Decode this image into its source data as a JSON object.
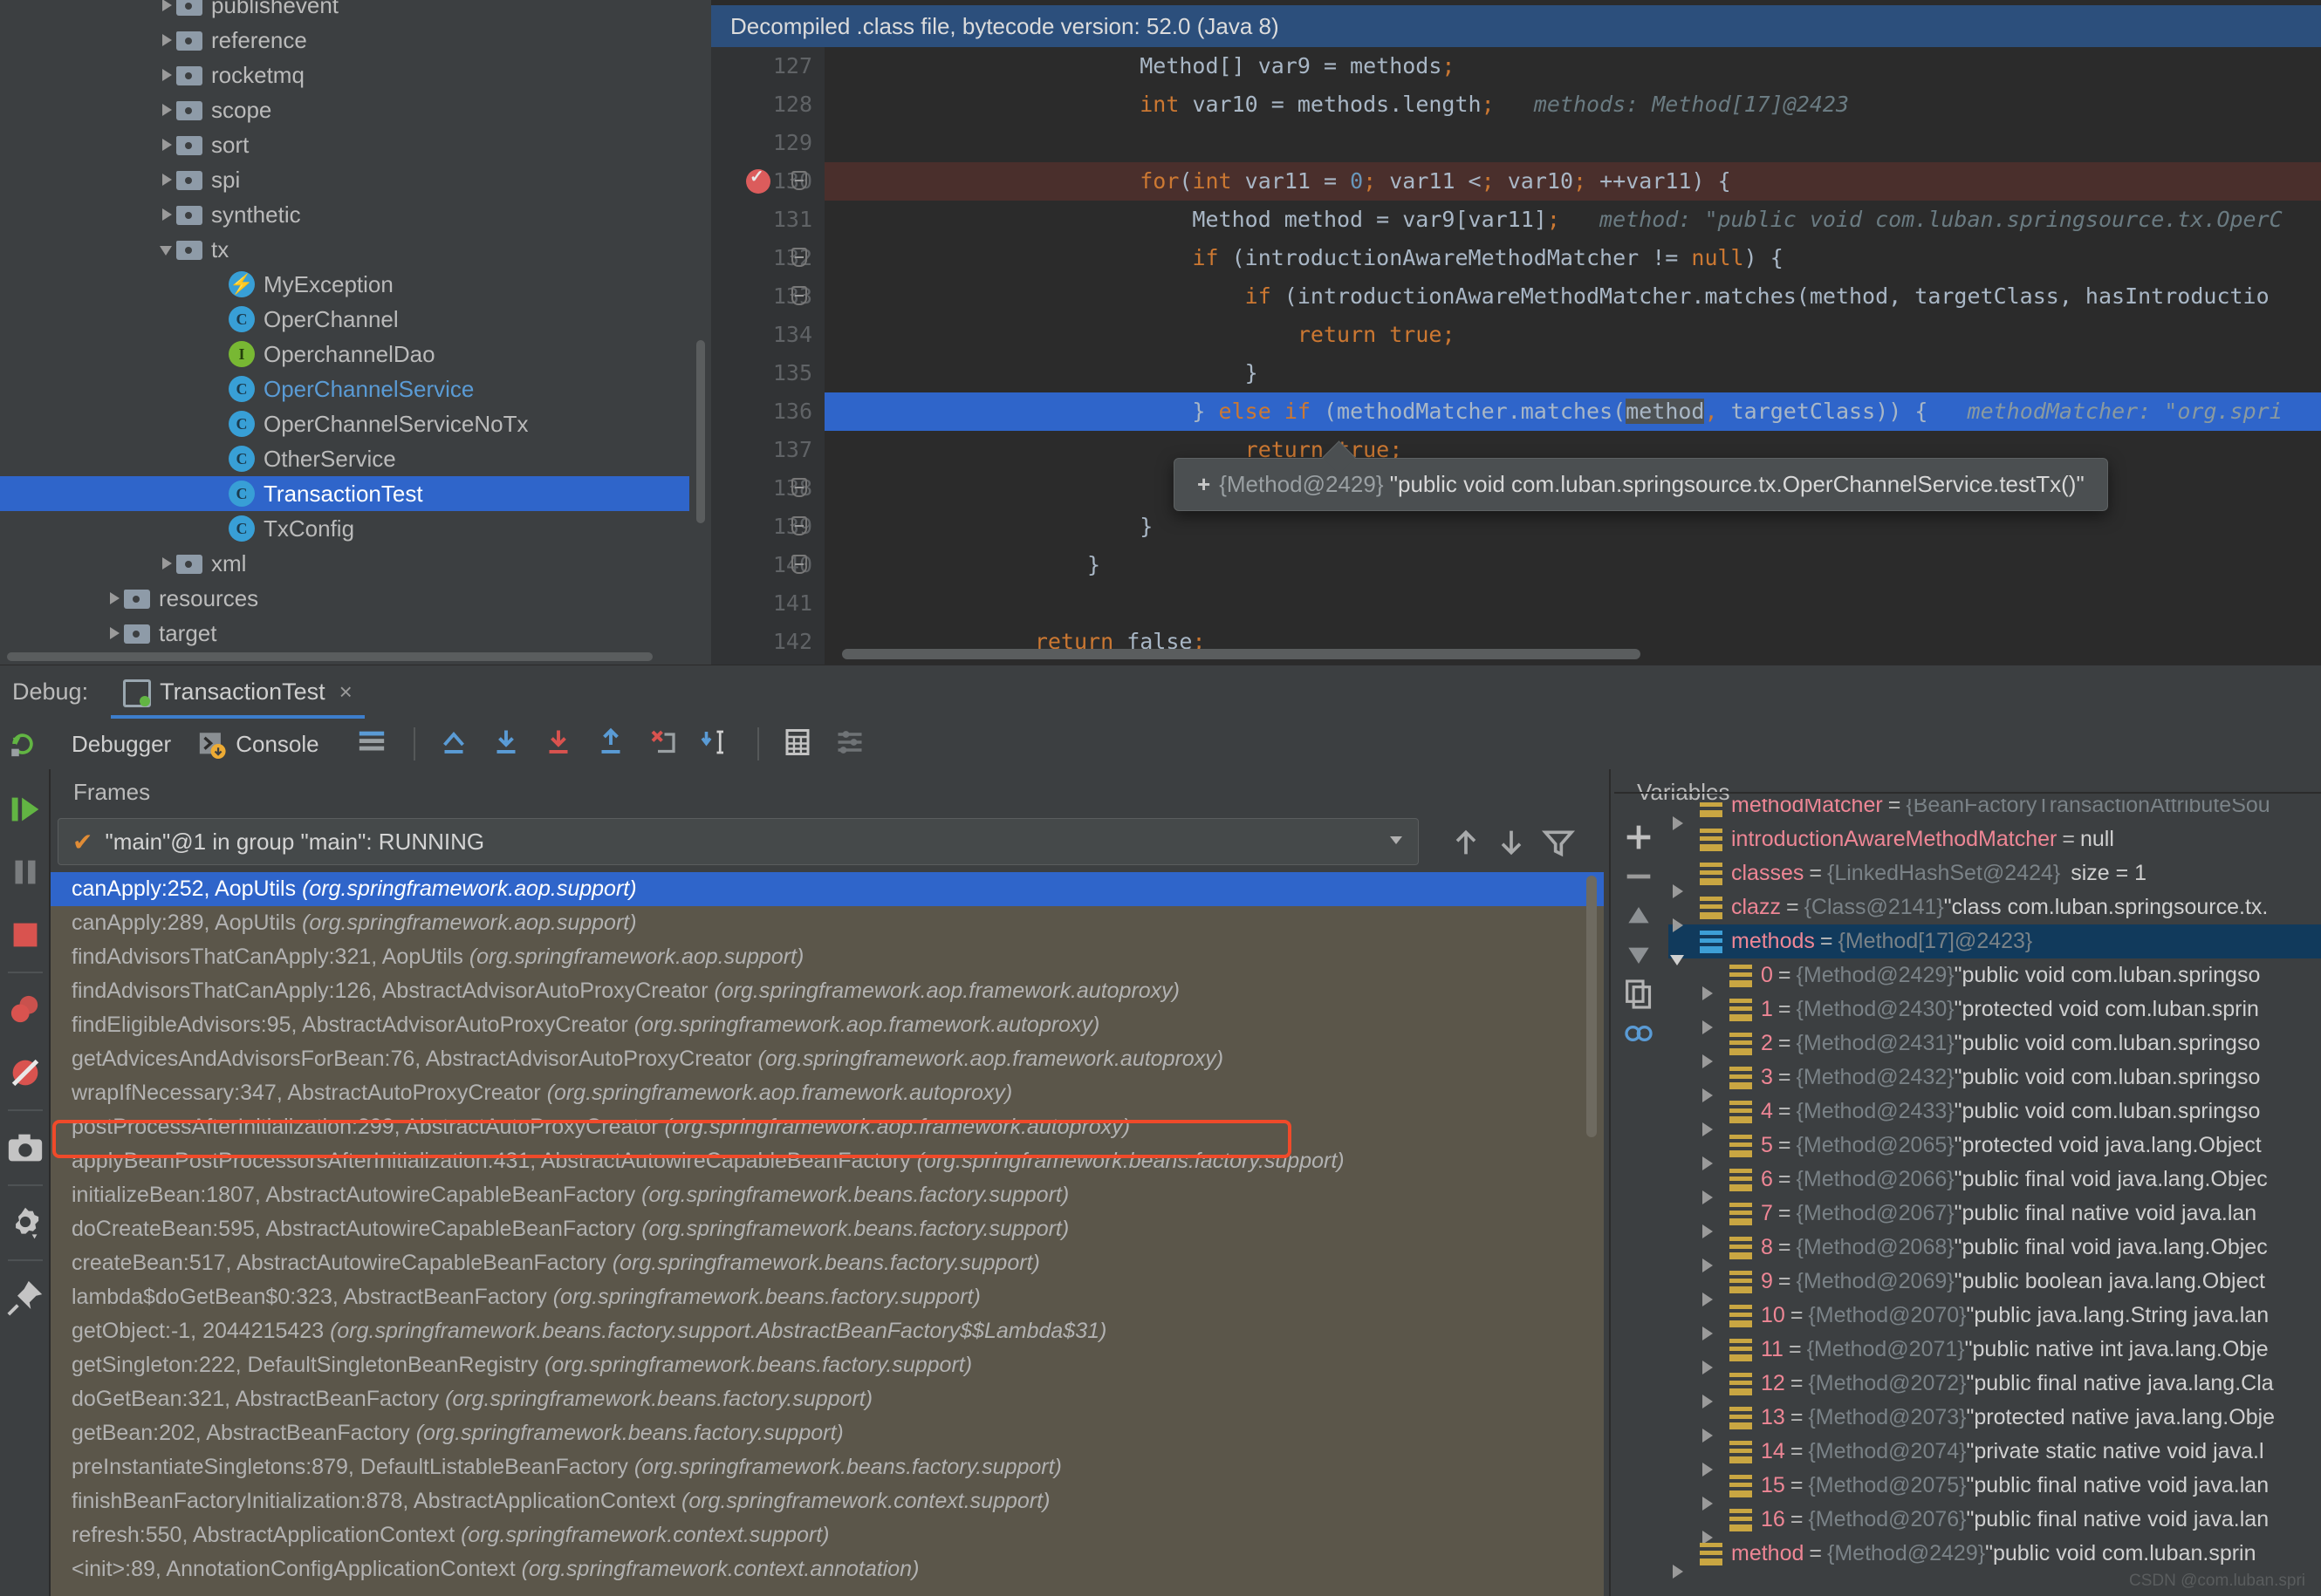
{
  "project_tree": {
    "items": [
      {
        "label": "publishevent",
        "type": "folder",
        "arrow": "closed",
        "indent": 1,
        "selected": false,
        "partial": true
      },
      {
        "label": "reference",
        "type": "folder",
        "arrow": "closed",
        "indent": 1,
        "selected": false
      },
      {
        "label": "rocketmq",
        "type": "folder",
        "arrow": "closed",
        "indent": 1,
        "selected": false
      },
      {
        "label": "scope",
        "type": "folder",
        "arrow": "closed",
        "indent": 1,
        "selected": false
      },
      {
        "label": "sort",
        "type": "folder",
        "arrow": "closed",
        "indent": 1,
        "selected": false
      },
      {
        "label": "spi",
        "type": "folder",
        "arrow": "closed",
        "indent": 1,
        "selected": false
      },
      {
        "label": "synthetic",
        "type": "folder",
        "arrow": "closed",
        "indent": 1,
        "selected": false
      },
      {
        "label": "tx",
        "type": "folder",
        "arrow": "open",
        "indent": 1,
        "selected": false
      },
      {
        "label": "MyException",
        "type": "exception",
        "arrow": "none",
        "indent": 2,
        "selected": false
      },
      {
        "label": "OperChannel",
        "type": "class",
        "arrow": "none",
        "indent": 2,
        "selected": false
      },
      {
        "label": "OperchannelDao",
        "type": "interface",
        "arrow": "none",
        "indent": 2,
        "selected": false
      },
      {
        "label": "OperChannelService",
        "type": "class",
        "arrow": "none",
        "indent": 2,
        "selected": false,
        "blue": true
      },
      {
        "label": "OperChannelServiceNoTx",
        "type": "class",
        "arrow": "none",
        "indent": 2,
        "selected": false
      },
      {
        "label": "OtherService",
        "type": "class",
        "arrow": "none",
        "indent": 2,
        "selected": false
      },
      {
        "label": "TransactionTest",
        "type": "class",
        "arrow": "none",
        "indent": 2,
        "selected": true
      },
      {
        "label": "TxConfig",
        "type": "class",
        "arrow": "none",
        "indent": 2,
        "selected": false
      },
      {
        "label": "xml",
        "type": "folder",
        "arrow": "closed",
        "indent": 1,
        "selected": false
      },
      {
        "label": "resources",
        "type": "folder",
        "arrow": "closed",
        "indent": 0,
        "selected": false
      },
      {
        "label": "target",
        "type": "folder",
        "arrow": "closed",
        "indent": 0,
        "selected": false
      }
    ]
  },
  "editor": {
    "decompiled_banner": "Decompiled .class file, bytecode version: 52.0 (Java 8)",
    "lines": [
      {
        "num": "127",
        "indent": "                        ",
        "html": "Method[] var9 = methods;",
        "hint": "",
        "state": "normal",
        "fold": false
      },
      {
        "num": "128",
        "indent": "                        ",
        "html": "int var10 = methods.length;",
        "hint": "methods: Method[17]@2423",
        "state": "normal",
        "fold": false
      },
      {
        "num": "129",
        "indent": "",
        "html": "",
        "hint": "",
        "state": "normal",
        "fold": false
      },
      {
        "num": "130",
        "indent": "                        ",
        "html": "for(int var11 = 0; var11 < var10; ++var11) {",
        "hint": "",
        "state": "breakpoint",
        "fold": true
      },
      {
        "num": "131",
        "indent": "                            ",
        "html": "Method method = var9[var11];",
        "hint": "method: \"public void com.luban.springsource.tx.OperC",
        "state": "normal",
        "fold": false
      },
      {
        "num": "132",
        "indent": "                            ",
        "html": "if (introductionAwareMethodMatcher != null) {",
        "hint": "",
        "state": "normal",
        "fold": true
      },
      {
        "num": "133",
        "indent": "                                ",
        "html": "if (introductionAwareMethodMatcher.matches(method, targetClass, hasIntroductio",
        "hint": "",
        "state": "normal",
        "fold": true
      },
      {
        "num": "134",
        "indent": "                                    ",
        "html": "return true;",
        "hint": "",
        "state": "normal",
        "fold": false
      },
      {
        "num": "135",
        "indent": "                                ",
        "html": "}",
        "hint": "",
        "state": "normal",
        "fold": false
      },
      {
        "num": "136",
        "indent": "                            ",
        "html": "} else if (methodMatcher.matches(method, targetClass)) {",
        "hint": "methodMatcher: \"org.spri",
        "state": "current",
        "fold": false
      },
      {
        "num": "137",
        "indent": "                                ",
        "html": "return true;",
        "hint": "",
        "state": "normal",
        "fold": false
      },
      {
        "num": "138",
        "indent": "                            ",
        "html": "}",
        "hint": "",
        "state": "normal",
        "fold": true
      },
      {
        "num": "139",
        "indent": "                        ",
        "html": "}",
        "hint": "",
        "state": "normal",
        "fold": true
      },
      {
        "num": "140",
        "indent": "                    ",
        "html": "}",
        "hint": "",
        "state": "normal",
        "fold": true
      },
      {
        "num": "141",
        "indent": "",
        "html": "",
        "hint": "",
        "state": "normal",
        "fold": false
      },
      {
        "num": "142",
        "indent": "                ",
        "html": "return false;",
        "hint": "",
        "state": "normal",
        "fold": false
      }
    ],
    "tooltip": {
      "plus": "+",
      "ref": "{Method@2429}",
      "value": "\"public void com.luban.springsource.tx.OperChannelService.testTx()\""
    }
  },
  "debug_header": {
    "label": "Debug:",
    "run_config": "TransactionTest",
    "close": "×"
  },
  "debug_toolbar": {
    "tabs": [
      {
        "label": "Debugger",
        "active": true,
        "icon": "debugger-icon"
      },
      {
        "label": "Console",
        "active": false,
        "icon": "console-icon"
      }
    ],
    "buttons": [
      {
        "name": "rerun-button",
        "icon": "rerun-icon"
      },
      {
        "name": "layout-settings-button",
        "icon": "lines-icon"
      },
      {
        "name": "show-execution-point-button",
        "icon": "execution-point-icon"
      },
      {
        "name": "step-over-button",
        "icon": "step-over-icon"
      },
      {
        "name": "step-into-button",
        "icon": "step-into-icon"
      },
      {
        "name": "step-out-button",
        "icon": "step-out-icon"
      },
      {
        "name": "force-step-into-button",
        "icon": "force-step-into-icon"
      },
      {
        "name": "run-to-cursor-button",
        "icon": "run-to-cursor-icon"
      },
      {
        "name": "evaluate-expression-button",
        "icon": "calculator-icon"
      },
      {
        "name": "settings-button",
        "icon": "sliders-icon"
      }
    ]
  },
  "left_rail": {
    "buttons": [
      {
        "name": "resume-program-button",
        "icon": "resume-icon"
      },
      {
        "name": "pause-program-button",
        "icon": "pause-icon"
      },
      {
        "name": "stop-button",
        "icon": "stop-icon"
      },
      {
        "name": "view-breakpoints-button",
        "icon": "breakpoints-icon"
      },
      {
        "name": "mute-breakpoints-button",
        "icon": "mute-breakpoints-icon"
      },
      {
        "name": "screenshot-button",
        "icon": "camera-icon"
      },
      {
        "name": "settings-button",
        "icon": "gear-icon"
      },
      {
        "name": "pin-tab-button",
        "icon": "pin-icon"
      }
    ]
  },
  "frames_panel": {
    "title": "Frames",
    "thread": "\"main\"@1 in group \"main\": RUNNING",
    "thread_check": "✔",
    "stack": [
      {
        "method": "canApply:252, AopUtils ",
        "pkg": "(org.springframework.aop.support)",
        "selected": true,
        "marked": false
      },
      {
        "method": "canApply:289, AopUtils ",
        "pkg": "(org.springframework.aop.support)",
        "selected": false,
        "marked": false
      },
      {
        "method": "findAdvisorsThatCanApply:321, AopUtils ",
        "pkg": "(org.springframework.aop.support)",
        "selected": false,
        "marked": false
      },
      {
        "method": "findAdvisorsThatCanApply:126, AbstractAdvisorAutoProxyCreator ",
        "pkg": "(org.springframework.aop.framework.autoproxy)",
        "selected": false,
        "marked": false
      },
      {
        "method": "findEligibleAdvisors:95, AbstractAdvisorAutoProxyCreator ",
        "pkg": "(org.springframework.aop.framework.autoproxy)",
        "selected": false,
        "marked": false
      },
      {
        "method": "getAdvicesAndAdvisorsForBean:76, AbstractAdvisorAutoProxyCreator ",
        "pkg": "(org.springframework.aop.framework.autoproxy)",
        "selected": false,
        "marked": false
      },
      {
        "method": "wrapIfNecessary:347, AbstractAutoProxyCreator ",
        "pkg": "(org.springframework.aop.framework.autoproxy)",
        "selected": false,
        "marked": false
      },
      {
        "method": "postProcessAfterInitialization:299, AbstractAutoProxyCreator ",
        "pkg": "(org.springframework.aop.framework.autoproxy)",
        "selected": false,
        "marked": true
      },
      {
        "method": "applyBeanPostProcessorsAfterInitialization:431, AbstractAutowireCapableBeanFactory ",
        "pkg": "(org.springframework.beans.factory.support)",
        "selected": false,
        "marked": false
      },
      {
        "method": "initializeBean:1807, AbstractAutowireCapableBeanFactory ",
        "pkg": "(org.springframework.beans.factory.support)",
        "selected": false,
        "marked": false
      },
      {
        "method": "doCreateBean:595, AbstractAutowireCapableBeanFactory ",
        "pkg": "(org.springframework.beans.factory.support)",
        "selected": false,
        "marked": false
      },
      {
        "method": "createBean:517, AbstractAutowireCapableBeanFactory ",
        "pkg": "(org.springframework.beans.factory.support)",
        "selected": false,
        "marked": false
      },
      {
        "method": "lambda$doGetBean$0:323, AbstractBeanFactory ",
        "pkg": "(org.springframework.beans.factory.support)",
        "selected": false,
        "marked": false
      },
      {
        "method": "getObject:-1, 2044215423 ",
        "pkg": "(org.springframework.beans.factory.support.AbstractBeanFactory$$Lambda$31)",
        "selected": false,
        "marked": false
      },
      {
        "method": "getSingleton:222, DefaultSingletonBeanRegistry ",
        "pkg": "(org.springframework.beans.factory.support)",
        "selected": false,
        "marked": false
      },
      {
        "method": "doGetBean:321, AbstractBeanFactory ",
        "pkg": "(org.springframework.beans.factory.support)",
        "selected": false,
        "marked": false
      },
      {
        "method": "getBean:202, AbstractBeanFactory ",
        "pkg": "(org.springframework.beans.factory.support)",
        "selected": false,
        "marked": false
      },
      {
        "method": "preInstantiateSingletons:879, DefaultListableBeanFactory ",
        "pkg": "(org.springframework.beans.factory.support)",
        "selected": false,
        "marked": false
      },
      {
        "method": "finishBeanFactoryInitialization:878, AbstractApplicationContext ",
        "pkg": "(org.springframework.context.support)",
        "selected": false,
        "marked": false
      },
      {
        "method": "refresh:550, AbstractApplicationContext ",
        "pkg": "(org.springframework.context.support)",
        "selected": false,
        "marked": false
      },
      {
        "method": "<init>:89, AnnotationConfigApplicationContext ",
        "pkg": "(org.springframework.context.annotation)",
        "selected": false,
        "marked": false
      }
    ]
  },
  "variables_panel": {
    "title": "Variables",
    "rows": [
      {
        "arrow": "closed",
        "icon": "field",
        "name": "methodMatcher",
        "eq": "=",
        "ref": "{BeanFactoryTransactionAttributeSou",
        "val": "",
        "size": "",
        "selected": false,
        "clipped": true
      },
      {
        "arrow": "none",
        "icon": "field",
        "name": "introductionAwareMethodMatcher",
        "eq": "=",
        "ref": "",
        "val": "null",
        "size": "",
        "selected": false
      },
      {
        "arrow": "closed",
        "icon": "field",
        "name": "classes",
        "eq": "=",
        "ref": "{LinkedHashSet@2424}",
        "val": "",
        "size": "size = 1",
        "selected": false
      },
      {
        "arrow": "closed",
        "icon": "field",
        "name": "clazz",
        "eq": "=",
        "ref": "{Class@2141}",
        "val": "\"class com.luban.springsource.tx.",
        "size": "",
        "selected": false
      },
      {
        "arrow": "open",
        "icon": "arr",
        "name": "methods",
        "eq": "=",
        "ref": "{Method[17]@2423}",
        "val": "",
        "size": "",
        "selected": true
      },
      {
        "arrow": "closed",
        "icon": "field",
        "name": "0",
        "eq": "=",
        "ref": "{Method@2429}",
        "val": "\"public void com.luban.springso",
        "size": "",
        "selected": false,
        "indent": 1
      },
      {
        "arrow": "closed",
        "icon": "field",
        "name": "1",
        "eq": "=",
        "ref": "{Method@2430}",
        "val": "\"protected void com.luban.sprin",
        "size": "",
        "selected": false,
        "indent": 1
      },
      {
        "arrow": "closed",
        "icon": "field",
        "name": "2",
        "eq": "=",
        "ref": "{Method@2431}",
        "val": "\"public void com.luban.springso",
        "size": "",
        "selected": false,
        "indent": 1
      },
      {
        "arrow": "closed",
        "icon": "field",
        "name": "3",
        "eq": "=",
        "ref": "{Method@2432}",
        "val": "\"public void com.luban.springso",
        "size": "",
        "selected": false,
        "indent": 1
      },
      {
        "arrow": "closed",
        "icon": "field",
        "name": "4",
        "eq": "=",
        "ref": "{Method@2433}",
        "val": "\"public void com.luban.springso",
        "size": "",
        "selected": false,
        "indent": 1
      },
      {
        "arrow": "closed",
        "icon": "field",
        "name": "5",
        "eq": "=",
        "ref": "{Method@2065}",
        "val": "\"protected void java.lang.Object",
        "size": "",
        "selected": false,
        "indent": 1
      },
      {
        "arrow": "closed",
        "icon": "field",
        "name": "6",
        "eq": "=",
        "ref": "{Method@2066}",
        "val": "\"public final void java.lang.Objec",
        "size": "",
        "selected": false,
        "indent": 1
      },
      {
        "arrow": "closed",
        "icon": "field",
        "name": "7",
        "eq": "=",
        "ref": "{Method@2067}",
        "val": "\"public final native void java.lan",
        "size": "",
        "selected": false,
        "indent": 1
      },
      {
        "arrow": "closed",
        "icon": "field",
        "name": "8",
        "eq": "=",
        "ref": "{Method@2068}",
        "val": "\"public final void java.lang.Objec",
        "size": "",
        "selected": false,
        "indent": 1
      },
      {
        "arrow": "closed",
        "icon": "field",
        "name": "9",
        "eq": "=",
        "ref": "{Method@2069}",
        "val": "\"public boolean java.lang.Object",
        "size": "",
        "selected": false,
        "indent": 1
      },
      {
        "arrow": "closed",
        "icon": "field",
        "name": "10",
        "eq": "=",
        "ref": "{Method@2070}",
        "val": "\"public java.lang.String java.lan",
        "size": "",
        "selected": false,
        "indent": 1
      },
      {
        "arrow": "closed",
        "icon": "field",
        "name": "11",
        "eq": "=",
        "ref": "{Method@2071}",
        "val": "\"public native int java.lang.Obje",
        "size": "",
        "selected": false,
        "indent": 1
      },
      {
        "arrow": "closed",
        "icon": "field",
        "name": "12",
        "eq": "=",
        "ref": "{Method@2072}",
        "val": "\"public final native java.lang.Cla",
        "size": "",
        "selected": false,
        "indent": 1
      },
      {
        "arrow": "closed",
        "icon": "field",
        "name": "13",
        "eq": "=",
        "ref": "{Method@2073}",
        "val": "\"protected native java.lang.Obje",
        "size": "",
        "selected": false,
        "indent": 1
      },
      {
        "arrow": "closed",
        "icon": "field",
        "name": "14",
        "eq": "=",
        "ref": "{Method@2074}",
        "val": "\"private static native void java.l",
        "size": "",
        "selected": false,
        "indent": 1
      },
      {
        "arrow": "closed",
        "icon": "field",
        "name": "15",
        "eq": "=",
        "ref": "{Method@2075}",
        "val": "\"public final native void java.lan",
        "size": "",
        "selected": false,
        "indent": 1
      },
      {
        "arrow": "closed",
        "icon": "field",
        "name": "16",
        "eq": "=",
        "ref": "{Method@2076}",
        "val": "\"public final native void java.lan",
        "size": "",
        "selected": false,
        "indent": 1
      },
      {
        "arrow": "closed",
        "icon": "field",
        "name": "method",
        "eq": "=",
        "ref": "{Method@2429}",
        "val": "\"public void com.luban.sprin",
        "size": "",
        "selected": false
      }
    ],
    "side_buttons": [
      {
        "name": "add-watch-button",
        "icon": "plus-icon"
      },
      {
        "name": "remove-watch-button",
        "icon": "minus-icon"
      },
      {
        "name": "move-up-button",
        "icon": "up-arrow-icon"
      },
      {
        "name": "move-down-button",
        "icon": "down-arrow-icon"
      },
      {
        "name": "copy-value-button",
        "icon": "copy-icon"
      },
      {
        "name": "compare-button",
        "icon": "link-icon"
      }
    ]
  },
  "watermark": "CSDN @com.luban.spri",
  "colors": {
    "accent": "#2f65ca",
    "breakpoint": "#db5c5c",
    "marked": "#f04a2a",
    "keyword": "#cc7832",
    "varname": "#ee8695"
  }
}
